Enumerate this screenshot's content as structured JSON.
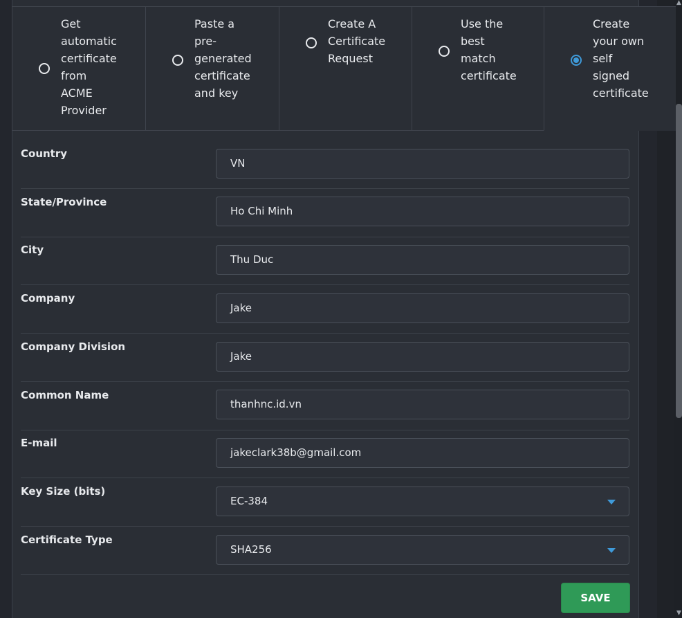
{
  "options": [
    {
      "label": "Get\nautomatic\ncertificate\nfrom\nACME\nProvider",
      "selected": false
    },
    {
      "label": "Paste a\npre-\ngenerated\ncertificate\nand key",
      "selected": false
    },
    {
      "label": "Create A\nCertificate\nRequest",
      "selected": false
    },
    {
      "label": "Use the\nbest\nmatch\ncertificate",
      "selected": false
    },
    {
      "label": "Create\nyour own\nself\nsigned\ncertificate",
      "selected": true
    }
  ],
  "form": {
    "country": {
      "label": "Country",
      "value": "VN"
    },
    "state": {
      "label": "State/Province",
      "value": "Ho Chi Minh"
    },
    "city": {
      "label": "City",
      "value": "Thu Duc"
    },
    "company": {
      "label": "Company",
      "value": "Jake"
    },
    "division": {
      "label": "Company Division",
      "value": "Jake"
    },
    "common_name": {
      "label": "Common Name",
      "value": "thanhnc.id.vn"
    },
    "email": {
      "label": "E-mail",
      "value": "jakeclark38b@gmail.com"
    },
    "key_size": {
      "label": "Key Size (bits)",
      "value": "EC-384"
    },
    "cert_type": {
      "label": "Certificate Type",
      "value": "SHA256"
    }
  },
  "save_label": "SAVE",
  "colors": {
    "accent_blue": "#3f9ad9",
    "save_green": "#2f9a57",
    "top_accent": "#d9481f"
  }
}
